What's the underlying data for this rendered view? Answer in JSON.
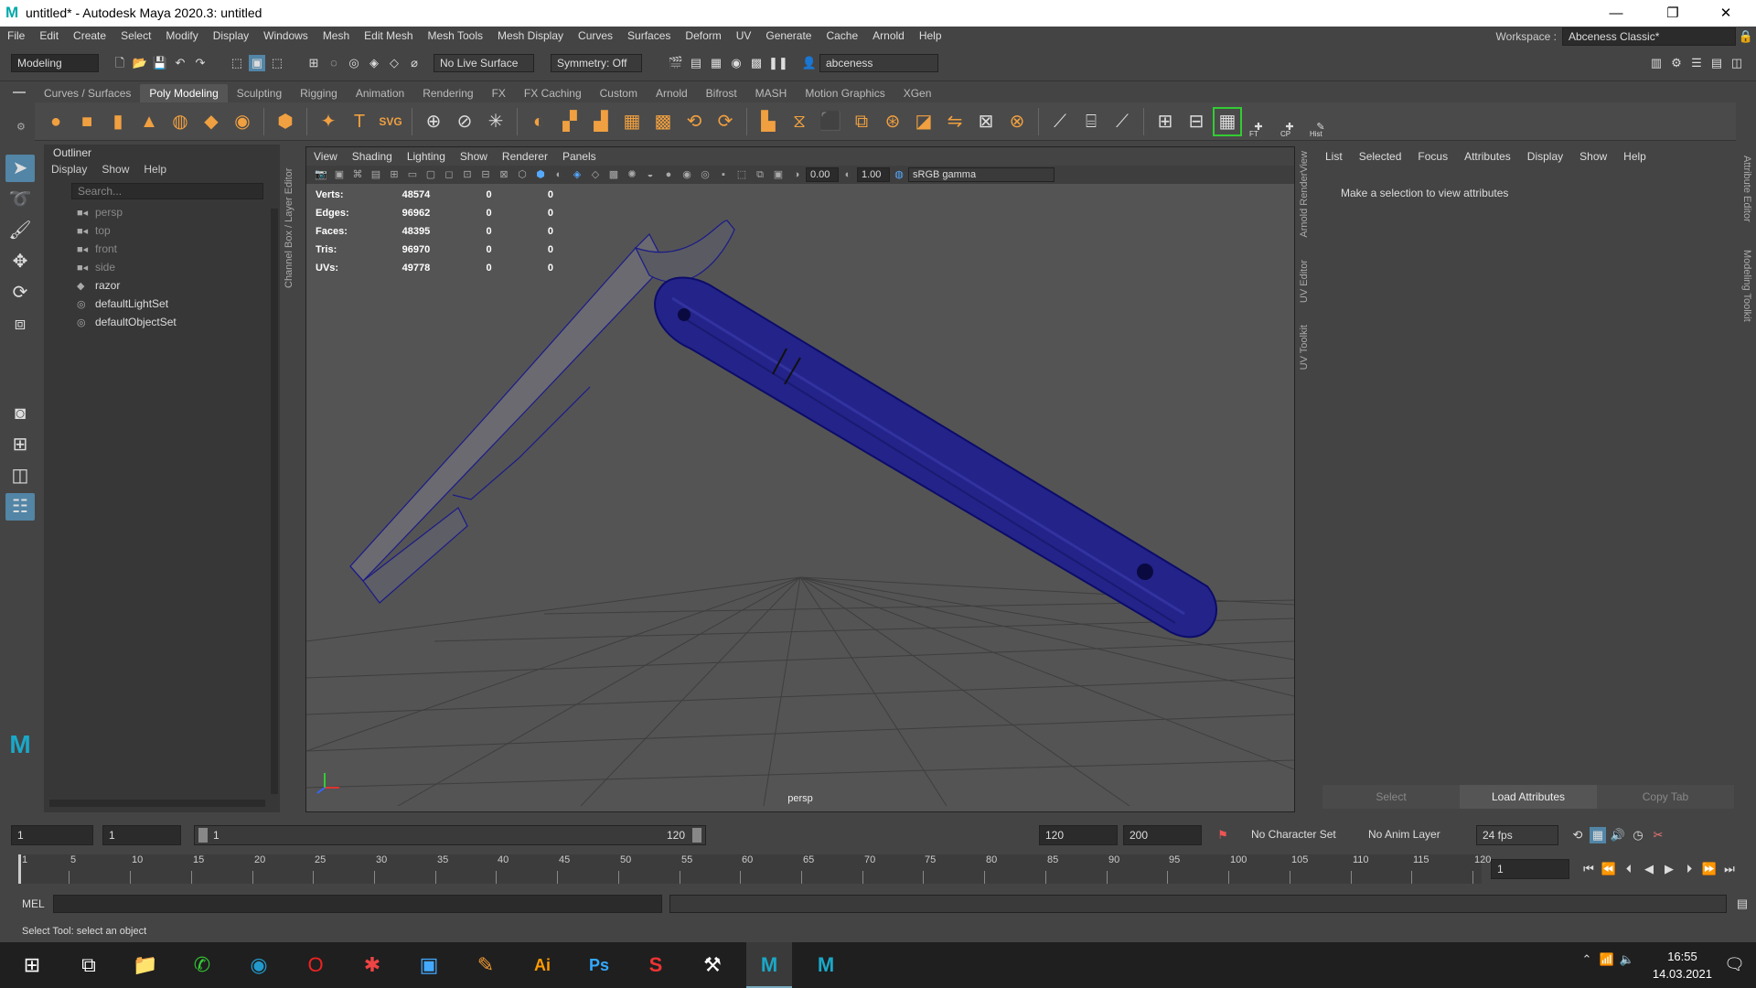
{
  "title": "untitled* - Autodesk Maya 2020.3: untitled",
  "window_buttons": [
    "—",
    "❐",
    "✕"
  ],
  "menu": [
    "File",
    "Edit",
    "Create",
    "Select",
    "Modify",
    "Display",
    "Windows",
    "Mesh",
    "Edit Mesh",
    "Mesh Tools",
    "Mesh Display",
    "Curves",
    "Surfaces",
    "Deform",
    "UV",
    "Generate",
    "Cache",
    "Arnold",
    "Help"
  ],
  "workspace": {
    "label": "Workspace :",
    "value": "Abceness Classic*"
  },
  "status": {
    "mode": "Modeling",
    "live_surface": "No Live Surface",
    "symmetry": "Symmetry: Off",
    "user": "abceness"
  },
  "shelf_tabs": [
    "Curves / Surfaces",
    "Poly Modeling",
    "Sculpting",
    "Rigging",
    "Animation",
    "Rendering",
    "FX",
    "FX Caching",
    "Custom",
    "Arnold",
    "Bifrost",
    "MASH",
    "Motion Graphics",
    "XGen"
  ],
  "shelf_active": "Poly Modeling",
  "shelf_labels": {
    "ft": "FT",
    "cp": "CP",
    "hist": "Hist"
  },
  "outliner": {
    "title": "Outliner",
    "menu": [
      "Display",
      "Show",
      "Help"
    ],
    "search_placeholder": "Search...",
    "items": [
      {
        "label": "persp",
        "dim": true
      },
      {
        "label": "top",
        "dim": true
      },
      {
        "label": "front",
        "dim": true
      },
      {
        "label": "side",
        "dim": true
      },
      {
        "label": "razor",
        "dim": false
      },
      {
        "label": "defaultLightSet",
        "dim": false
      },
      {
        "label": "defaultObjectSet",
        "dim": false
      }
    ]
  },
  "channel_box_tab": "Channel Box / Layer Editor",
  "viewport": {
    "menu": [
      "View",
      "Shading",
      "Lighting",
      "Show",
      "Renderer",
      "Panels"
    ],
    "exposure": "0.00",
    "gamma": "1.00",
    "color_space": "sRGB gamma",
    "camera": "persp",
    "hud": [
      {
        "k": "Verts:",
        "v": "48574",
        "a": "0",
        "b": "0"
      },
      {
        "k": "Edges:",
        "v": "96962",
        "a": "0",
        "b": "0"
      },
      {
        "k": "Faces:",
        "v": "48395",
        "a": "0",
        "b": "0"
      },
      {
        "k": "Tris:",
        "v": "96970",
        "a": "0",
        "b": "0"
      },
      {
        "k": "UVs:",
        "v": "49778",
        "a": "0",
        "b": "0"
      }
    ]
  },
  "side_tabs": [
    "Arnold RenderView",
    "UV Editor",
    "UV Toolkit"
  ],
  "attr": {
    "menu": [
      "List",
      "Selected",
      "Focus",
      "Attributes",
      "Display",
      "Show",
      "Help"
    ],
    "message": "Make a selection to view attributes",
    "buttons": [
      "Select",
      "Load Attributes",
      "Copy Tab"
    ]
  },
  "right_tabs": [
    "Attribute Editor",
    "Modeling Toolkit"
  ],
  "range": {
    "start": "1",
    "start2": "1",
    "slider_start": "1",
    "slider_end": "120",
    "end": "120",
    "end2": "200",
    "char_set": "No Character Set",
    "anim_layer": "No Anim Layer",
    "fps": "24 fps"
  },
  "timeline": {
    "ticks": [
      "1",
      "5",
      "10",
      "15",
      "20",
      "25",
      "30",
      "35",
      "40",
      "45",
      "50",
      "55",
      "60",
      "65",
      "70",
      "75",
      "80",
      "85",
      "90",
      "95",
      "100",
      "105",
      "110",
      "115",
      "120"
    ],
    "current": "1"
  },
  "mel_label": "MEL",
  "help_line": "Select Tool: select an object",
  "clock": {
    "time": "16:55",
    "date": "14.03.2021"
  }
}
